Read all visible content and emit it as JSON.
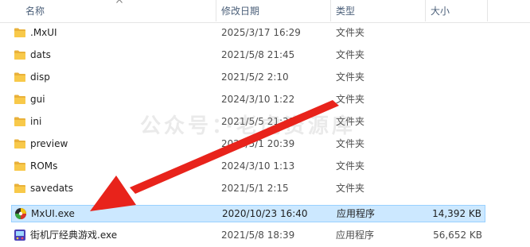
{
  "columns": {
    "name": "名称",
    "date": "修改日期",
    "type": "类型",
    "size": "大小"
  },
  "files": [
    {
      "name": ".MxUI",
      "date": "2025/3/17 16:29",
      "type": "文件夹",
      "size": "",
      "icon": "folder-icon"
    },
    {
      "name": "dats",
      "date": "2021/5/8 21:45",
      "type": "文件夹",
      "size": "",
      "icon": "folder-icon"
    },
    {
      "name": "disp",
      "date": "2021/5/2 2:10",
      "type": "文件夹",
      "size": "",
      "icon": "folder-icon"
    },
    {
      "name": "gui",
      "date": "2024/3/10 1:22",
      "type": "文件夹",
      "size": "",
      "icon": "folder-icon"
    },
    {
      "name": "ini",
      "date": "2021/5/5 21:39",
      "type": "文件夹",
      "size": "",
      "icon": "folder-icon"
    },
    {
      "name": "preview",
      "date": "2021/5/1 20:39",
      "type": "文件夹",
      "size": "",
      "icon": "folder-icon"
    },
    {
      "name": "ROMs",
      "date": "2024/3/10 1:13",
      "type": "文件夹",
      "size": "",
      "icon": "folder-icon"
    },
    {
      "name": "savedats",
      "date": "2021/5/1 2:15",
      "type": "文件夹",
      "size": "",
      "icon": "folder-icon"
    },
    {
      "name": "MxUI.exe",
      "date": "2020/10/23 16:40",
      "type": "应用程序",
      "size": "14,392 KB",
      "icon": "mxui-app-icon",
      "selected": true
    },
    {
      "name": "街机厅经典游戏.exe",
      "date": "2021/5/8 18:39",
      "type": "应用程序",
      "size": "56,652 KB",
      "icon": "arcade-app-icon"
    }
  ],
  "watermark": "公众号：·老虎资源库",
  "colors": {
    "selection": "#cce8ff",
    "selection_border": "#99d1ff",
    "folder": "#f8c94a",
    "arrow": "#e8231b"
  }
}
